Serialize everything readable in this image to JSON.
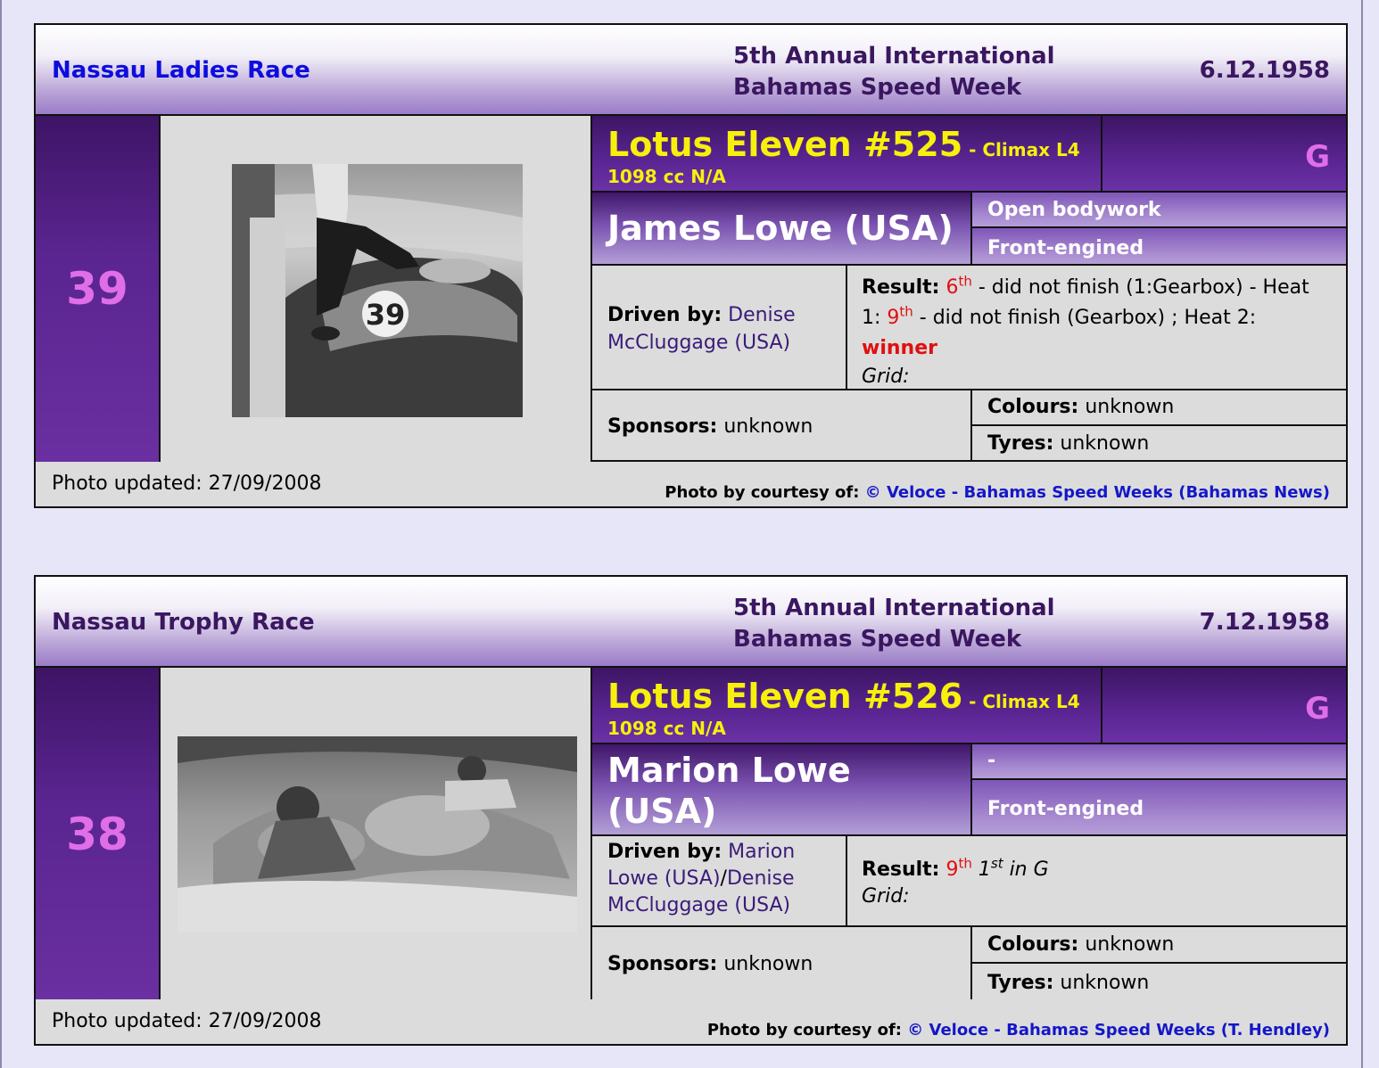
{
  "cards": [
    {
      "race_name": "Nassau Ladies Race",
      "race_name_color": "#0d0ddd",
      "event_line1": "5th Annual International",
      "event_line2": "Bahamas Speed Week",
      "date": "6.12.1958",
      "number": "39",
      "car": "Lotus Eleven #525",
      "engine": " - Climax L4",
      "cc": "1098 cc N/A",
      "class": "G",
      "entrant": "James Lowe (USA)",
      "attr1": "Open bodywork",
      "attr2": "Front-engined",
      "driven_label": "Driven by:",
      "driver1": "Denise McCluggage (USA)",
      "result_label": "Result:",
      "result_pos": "6",
      "result_pos_sup": "th",
      "result_text1": " - did not finish (1:Gearbox) - Heat 1: ",
      "heat1_pos": "9",
      "heat1_sup": "th",
      "result_text2": " - did not finish (Gearbox) ; Heat 2: ",
      "heat2_result": "winner",
      "grid_label": "Grid:",
      "sponsors_label": "Sponsors:",
      "sponsors": "unknown",
      "colours_label": "Colours:",
      "colours": "unknown",
      "tyres_label": "Tyres:",
      "tyres": "unknown",
      "photo_updated": "Photo updated: 27/09/2008",
      "courtesy_label": "Photo by courtesy of: ",
      "courtesy_link": "© Veloce - Bahamas Speed Weeks (Bahamas News)"
    },
    {
      "race_name": "Nassau Trophy Race",
      "race_name_color": "#3a1760",
      "event_line1": "5th Annual International",
      "event_line2": "Bahamas Speed Week",
      "date": "7.12.1958",
      "number": "38",
      "car": "Lotus Eleven #526",
      "engine": " - Climax L4",
      "cc": "1098 cc N/A",
      "class": "G",
      "entrant": "Marion Lowe (USA)",
      "attr1": "-",
      "attr2": "Front-engined",
      "driven_label": "Driven by:",
      "driver1": "Marion Lowe (USA)",
      "driver_sep": "/",
      "driver2": "Denise McCluggage (USA)",
      "result_label": "Result:",
      "result_pos": "9",
      "result_pos_sup": "th",
      "class_pos": "1",
      "class_pos_sup": "st",
      "class_text": " in G",
      "grid_label": "Grid:",
      "sponsors_label": "Sponsors:",
      "sponsors": "unknown",
      "colours_label": "Colours:",
      "colours": "unknown",
      "tyres_label": "Tyres:",
      "tyres": "unknown",
      "photo_updated": "Photo updated: 27/09/2008",
      "courtesy_label": "Photo by courtesy of: ",
      "courtesy_link": "© Veloce - Bahamas Speed Weeks (T. Hendley)"
    }
  ]
}
